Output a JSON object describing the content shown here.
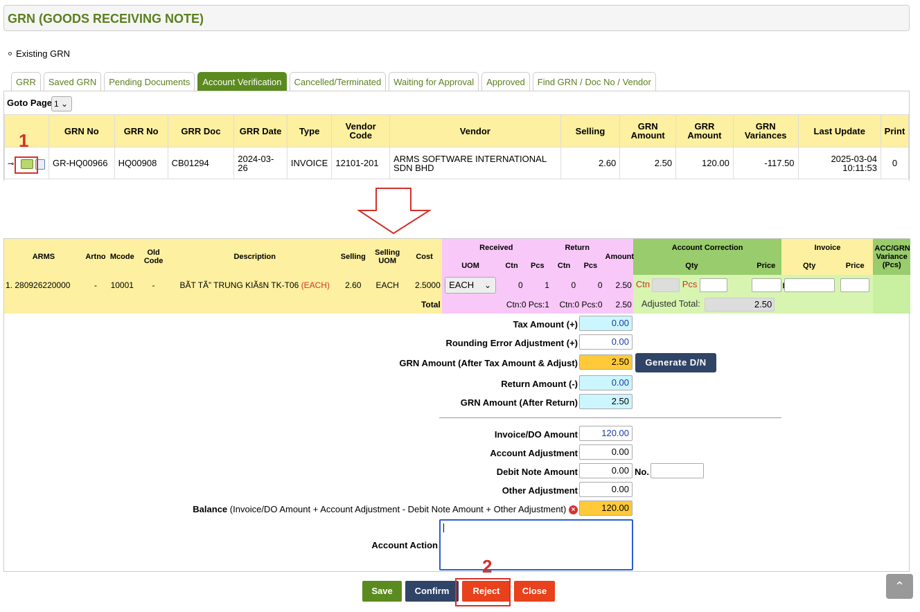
{
  "page": {
    "title": "GRN (GOODS RECEIVING NOTE)",
    "existing_label": "Existing GRN"
  },
  "tabs": [
    {
      "label": "GRR"
    },
    {
      "label": "Saved GRN"
    },
    {
      "label": "Pending Documents"
    },
    {
      "label": "Account Verification",
      "active": true
    },
    {
      "label": "Cancelled/Terminated"
    },
    {
      "label": "Waiting for Approval"
    },
    {
      "label": "Approved"
    },
    {
      "label": "Find GRN / Doc No / Vendor"
    }
  ],
  "goto": {
    "label": "Goto Page",
    "value": "1"
  },
  "grn_table": {
    "headers": [
      "GRN No",
      "GRR No",
      "GRR Doc",
      "GRR Date",
      "Type",
      "Vendor Code",
      "Vendor",
      "Selling",
      "GRN Amount",
      "GRR Amount",
      "GRN Variances",
      "Last Update",
      "Print"
    ],
    "row": {
      "grn_no": "GR-HQ00966",
      "grr_no": "HQ00908",
      "grr_doc": "CB01294",
      "grr_date": "2024-03-26",
      "type": "INVOICE",
      "vendor_code": "12101-201",
      "vendor": "ARMS SOFTWARE INTERNATIONAL SDN BHD",
      "selling": "2.60",
      "grn_amount": "2.50",
      "grr_amount": "120.00",
      "grn_variances": "-117.50",
      "last_update_date": "2025-03-04",
      "last_update_time": "10:11:53",
      "print": "0"
    }
  },
  "annotations": {
    "step1": "1",
    "step2": "2"
  },
  "detail": {
    "headers": {
      "arms": "ARMS",
      "artno": "Artno",
      "mcode": "Mcode",
      "old_code": "Old Code",
      "description": "Description",
      "selling": "Selling",
      "selling_uom": "Selling UOM",
      "cost": "Cost",
      "received": "Received",
      "return": "Return",
      "amount": "Amount",
      "account_correction": "Account Correction",
      "invoice": "Invoice",
      "variance": "ACC/GRN Variance (Pcs)",
      "uom": "UOM",
      "ctn": "Ctn",
      "pcs": "Pcs",
      "qty": "Qty",
      "price": "Price"
    },
    "item": {
      "no": "1.",
      "arms": "280926220000",
      "artno": "-",
      "mcode": "10001",
      "old_code": "-",
      "description": "BÃT TÃ” TRUNG KIÃšN TK-T06",
      "description_uom": "(EACH)",
      "selling": "2.60",
      "selling_uom": "EACH",
      "cost": "2.5000",
      "uom_select": "EACH",
      "rec_ctn": "0",
      "rec_pcs": "1",
      "ret_ctn": "0",
      "ret_pcs": "0",
      "amount": "2.50",
      "corr_ctn_label": "Ctn",
      "corr_pcs_label": "Pcs"
    },
    "total": {
      "label": "Total",
      "received": "Ctn:0 Pcs:1",
      "return": "Ctn:0 Pcs:0",
      "amount": "2.50",
      "adjusted_label": "Adjusted Total:",
      "adjusted_value": "2.50"
    }
  },
  "summary": {
    "tax_label": "Tax Amount (+)",
    "tax_value": "0.00",
    "rounding_label": "Rounding Error Adjustment (+)",
    "rounding_value": "0.00",
    "grn_after_tax_label": "GRN Amount (After Tax Amount & Adjust)",
    "grn_after_tax_value": "2.50",
    "generate_dn": "Generate D/N",
    "return_label": "Return Amount (-)",
    "return_value": "0.00",
    "grn_after_return_label": "GRN Amount (After Return)",
    "grn_after_return_value": "2.50",
    "invoice_label": "Invoice/DO Amount",
    "invoice_value": "120.00",
    "account_adj_label": "Account Adjustment",
    "account_adj_value": "0.00",
    "debit_note_label": "Debit Note Amount",
    "debit_note_value": "0.00",
    "no_label": "No.",
    "other_adj_label": "Other Adjustment",
    "other_adj_value": "0.00",
    "balance_label": "Balance",
    "balance_formula": "(Invoice/DO Amount + Account Adjustment - Debit Note Amount + Other Adjustment)",
    "balance_value": "120.00",
    "account_action_label": "Account Action"
  },
  "buttons": {
    "save": "Save",
    "confirm": "Confirm",
    "reject": "Reject",
    "close": "Close"
  },
  "colors": {
    "brand_green": "#5b8a1e",
    "danger": "#e8411c",
    "navy": "#2f4466",
    "header_yellow": "#fdf0a0"
  }
}
